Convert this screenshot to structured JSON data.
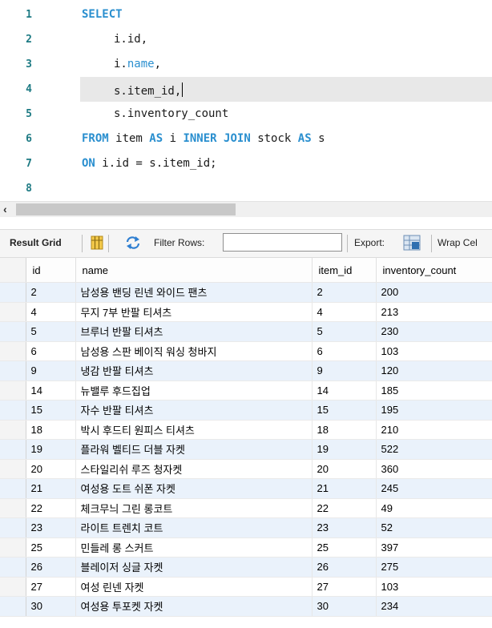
{
  "editor": {
    "line_numbers": [
      "1",
      "2",
      "3",
      "4",
      "5",
      "6",
      "7",
      "8"
    ],
    "lines": {
      "l1_select": "SELECT",
      "l2": "i.id,",
      "l3_obj": "i.",
      "l3_field": "name",
      "l3_comma": ",",
      "l4": "s.item_id,",
      "l5": "s.inventory_count",
      "l6_from": "FROM",
      "l6_table1": " item ",
      "l6_as1": "AS",
      "l6_alias1": " i ",
      "l6_inner": "INNER",
      "l6_sp": " ",
      "l6_join": "JOIN",
      "l6_table2": " stock ",
      "l6_as2": "AS",
      "l6_alias2": " s",
      "l7_on": "ON",
      "l7_rest": " i.id = s.item_id;"
    }
  },
  "scrollbar": {
    "left_arrow": "‹"
  },
  "toolbar": {
    "result_grid_label": "Result Grid",
    "filter_rows_label": "Filter Rows:",
    "filter_value": "",
    "export_label": "Export:",
    "wrap_label": "Wrap Cel"
  },
  "grid": {
    "columns": [
      "id",
      "name",
      "item_id",
      "inventory_count"
    ],
    "rows": [
      [
        "2",
        "남성용 밴딩 린넨 와이드 팬츠",
        "2",
        "200"
      ],
      [
        "4",
        "무지 7부 반팔 티셔츠",
        "4",
        "213"
      ],
      [
        "5",
        "브루너 반팔 티셔츠",
        "5",
        "230"
      ],
      [
        "6",
        "남성용 스판 베이직 워싱 청바지",
        "6",
        "103"
      ],
      [
        "9",
        "냉감 반팔 티셔츠",
        "9",
        "120"
      ],
      [
        "14",
        "뉴밸루 후드집업",
        "14",
        "185"
      ],
      [
        "15",
        "자수 반팔 티셔츠",
        "15",
        "195"
      ],
      [
        "18",
        "박시 후드티 원피스 티셔츠",
        "18",
        "210"
      ],
      [
        "19",
        "플라워 벨티드 더블 자켓",
        "19",
        "522"
      ],
      [
        "20",
        "스타일리쉬 루즈 청자켓",
        "20",
        "360"
      ],
      [
        "21",
        "여성용 도트 쉬폰 자켓",
        "21",
        "245"
      ],
      [
        "22",
        "체크무늬 그린 롱코트",
        "22",
        "49"
      ],
      [
        "23",
        "라이트 트렌치 코트",
        "23",
        "52"
      ],
      [
        "25",
        "민들레 롱 스커트",
        "25",
        "397"
      ],
      [
        "26",
        "블레이저 싱글 자켓",
        "26",
        "275"
      ],
      [
        "27",
        "여성 린넨 자켓",
        "27",
        "103"
      ],
      [
        "30",
        "여성용 투포켓 자켓",
        "30",
        "234"
      ]
    ]
  }
}
